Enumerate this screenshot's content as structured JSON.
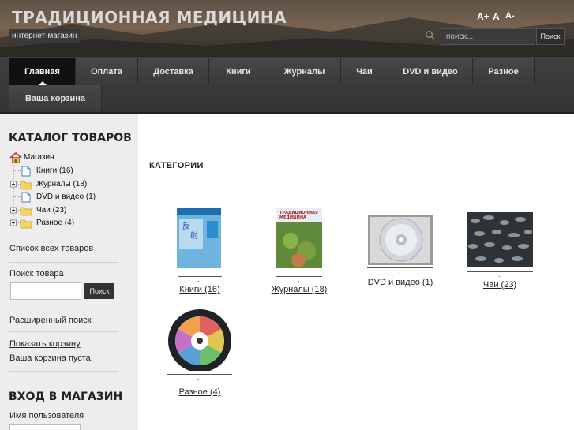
{
  "header": {
    "title": "ТРАДИЦИОННАЯ МЕДИЦИНА",
    "subtitle": "интернет-магазин",
    "font_sizer": [
      "A+",
      "A",
      "A-"
    ],
    "search": {
      "placeholder": "поиск...",
      "button_label": "Поиск"
    }
  },
  "nav": {
    "items": [
      {
        "label": "Главная",
        "active": true
      },
      {
        "label": "Оплата"
      },
      {
        "label": "Доставка"
      },
      {
        "label": "Книги"
      },
      {
        "label": "Журналы"
      },
      {
        "label": "Чаи"
      },
      {
        "label": "DVD и видео"
      },
      {
        "label": "Разное"
      },
      {
        "label": "Ваша корзина"
      }
    ]
  },
  "sidebar": {
    "catalog_title": "КАТАЛОГ ТОВАРОВ",
    "tree": {
      "root": "Магазин",
      "items": [
        {
          "label": "Книги (16)",
          "type": "file"
        },
        {
          "label": "Журналы (18)",
          "type": "folder"
        },
        {
          "label": "DVD и видео (1)",
          "type": "file"
        },
        {
          "label": "Чаи (23)",
          "type": "folder"
        },
        {
          "label": "Разное (4)",
          "type": "folder"
        }
      ]
    },
    "all_products_link": "Список всех товаров",
    "search_label": "Поиск товара",
    "search_button": "Поиск",
    "advanced_search": "Расширенный поиск",
    "show_cart_link": "Показать корзину",
    "cart_status": "Ваша корзина пуста.",
    "login_title": "ВХОД В МАГАЗИН",
    "username_label": "Имя пользователя"
  },
  "main": {
    "heading": "КАТЕГОРИИ",
    "categories": [
      {
        "label": "Книги (16)",
        "icon": "book-cover-thumbnail"
      },
      {
        "label": "Журналы (18)",
        "icon": "magazine-cover-thumbnail"
      },
      {
        "label": "DVD и видео (1)",
        "icon": "dvd-case-thumbnail"
      },
      {
        "label": "Чаи (23)",
        "icon": "tea-leaves-thumbnail"
      },
      {
        "label": "Разное (4)",
        "icon": "round-chart-thumbnail"
      }
    ]
  },
  "colors": {
    "header_bg": "#4a4038",
    "nav_bg": "#3a3a3a",
    "nav_active": "#111111",
    "sidebar_bg": "#ededed"
  }
}
